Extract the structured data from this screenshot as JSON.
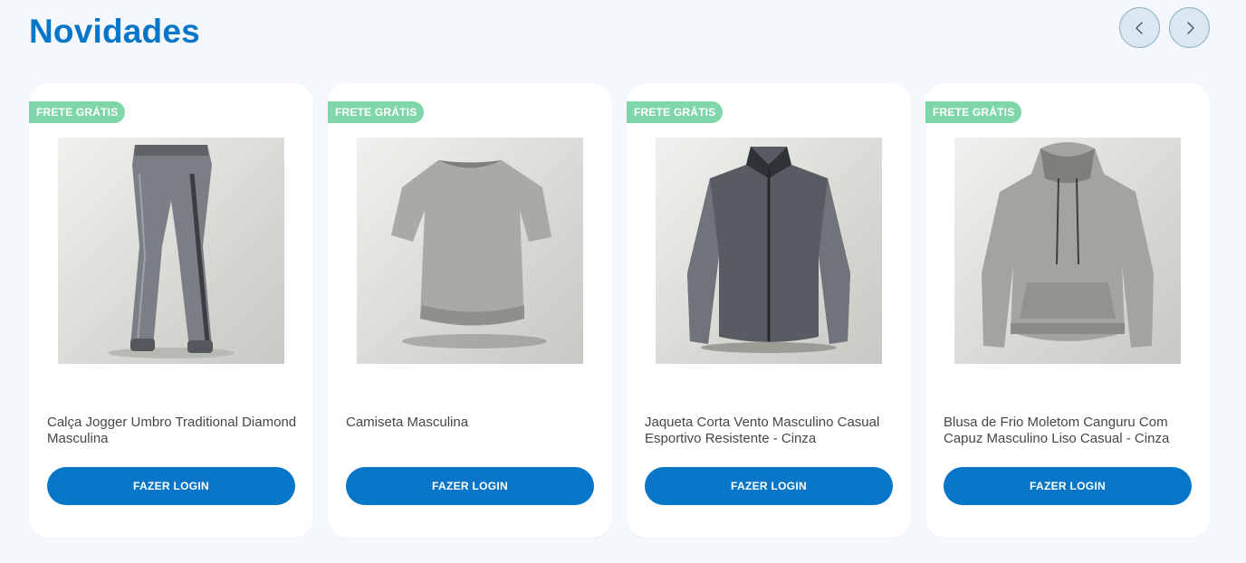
{
  "section": {
    "title": "Novidades"
  },
  "nav": {
    "prev_icon": "chevron-left-icon",
    "next_icon": "chevron-right-icon"
  },
  "colors": {
    "brand": "#0876c8",
    "badge": "#7fd6a9",
    "background": "#f4f7fb"
  },
  "products": [
    {
      "badge": "FRETE GRÁTIS",
      "name": "Calça Jogger Umbro Traditional Diamond Masculina",
      "button": "FAZER LOGIN",
      "image": "jogger-pants-image"
    },
    {
      "badge": "FRETE GRÁTIS",
      "name": "Camiseta Masculina",
      "button": "FAZER LOGIN",
      "image": "t-shirt-image"
    },
    {
      "badge": "FRETE GRÁTIS",
      "name": "Jaqueta Corta Vento Masculino Casual Esportivo Resistente - Cinza",
      "button": "FAZER LOGIN",
      "image": "zip-jacket-image"
    },
    {
      "badge": "FRETE GRÁTIS",
      "name": "Blusa de Frio Moletom Canguru Com Capuz Masculino Liso Casual - Cinza",
      "button": "FAZER LOGIN",
      "image": "hoodie-image"
    }
  ]
}
